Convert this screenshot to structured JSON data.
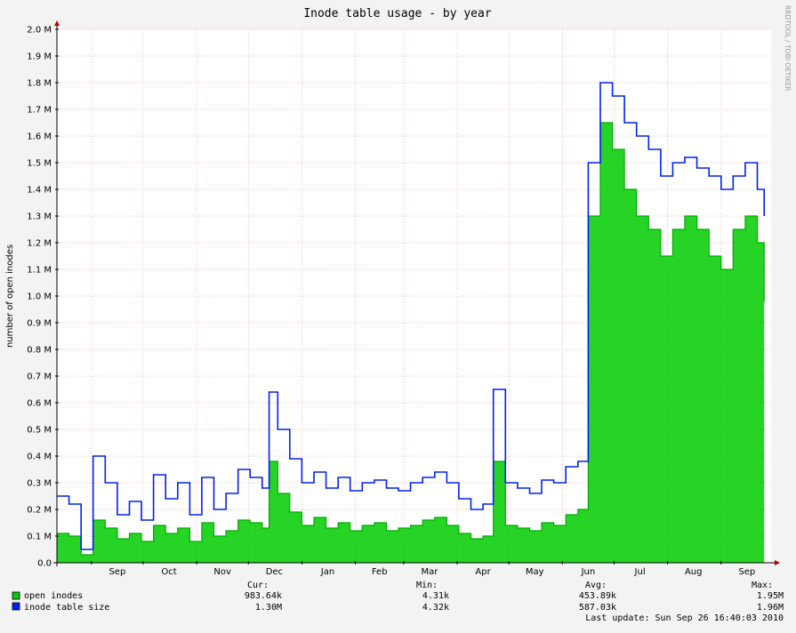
{
  "chart_data": {
    "type": "area",
    "title": "Inode table usage - by year",
    "ylabel": "number of open inodes",
    "watermark": "RRDTOOL / TOBI OETIKER",
    "ylim": [
      0,
      2000000
    ],
    "y_ticks": [
      {
        "value": 0,
        "label": "0.0"
      },
      {
        "value": 100000,
        "label": "0.1 M"
      },
      {
        "value": 200000,
        "label": "0.2 M"
      },
      {
        "value": 300000,
        "label": "0.3 M"
      },
      {
        "value": 400000,
        "label": "0.4 M"
      },
      {
        "value": 500000,
        "label": "0.5 M"
      },
      {
        "value": 600000,
        "label": "0.6 M"
      },
      {
        "value": 700000,
        "label": "0.7 M"
      },
      {
        "value": 800000,
        "label": "0.8 M"
      },
      {
        "value": 900000,
        "label": "0.9 M"
      },
      {
        "value": 1000000,
        "label": "1.0 M"
      },
      {
        "value": 1100000,
        "label": "1.1 M"
      },
      {
        "value": 1200000,
        "label": "1.2 M"
      },
      {
        "value": 1300000,
        "label": "1.3 M"
      },
      {
        "value": 1400000,
        "label": "1.4 M"
      },
      {
        "value": 1500000,
        "label": "1.5 M"
      },
      {
        "value": 1600000,
        "label": "1.6 M"
      },
      {
        "value": 1700000,
        "label": "1.7 M"
      },
      {
        "value": 1800000,
        "label": "1.8 M"
      },
      {
        "value": 1900000,
        "label": "1.9 M"
      },
      {
        "value": 2000000,
        "label": "2.0 M"
      }
    ],
    "x_range": [
      "2009-08-12",
      "2010-09-30"
    ],
    "x_month_starts": [
      "2009-09-01",
      "2009-10-01",
      "2009-11-01",
      "2009-12-01",
      "2010-01-01",
      "2010-02-01",
      "2010-03-01",
      "2010-04-01",
      "2010-05-01",
      "2010-06-01",
      "2010-07-01",
      "2010-08-01",
      "2010-09-01"
    ],
    "x_labels": [
      {
        "label": "Sep",
        "date": "2009-09-16"
      },
      {
        "label": "Oct",
        "date": "2009-10-16"
      },
      {
        "label": "Nov",
        "date": "2009-11-16"
      },
      {
        "label": "Dec",
        "date": "2009-12-16"
      },
      {
        "label": "Jan",
        "date": "2010-01-16"
      },
      {
        "label": "Feb",
        "date": "2010-02-15"
      },
      {
        "label": "Mar",
        "date": "2010-03-16"
      },
      {
        "label": "Apr",
        "date": "2010-04-16"
      },
      {
        "label": "May",
        "date": "2010-05-16"
      },
      {
        "label": "Jun",
        "date": "2010-06-16"
      },
      {
        "label": "Jul",
        "date": "2010-07-16"
      },
      {
        "label": "Aug",
        "date": "2010-08-16"
      },
      {
        "label": "Sep",
        "date": "2010-09-16"
      }
    ],
    "grid": true,
    "series": [
      {
        "name": "inode table size",
        "color": "#0022ee",
        "kind": "line",
        "points": [
          [
            "2009-08-12",
            250000
          ],
          [
            "2009-08-19",
            220000
          ],
          [
            "2009-08-26",
            50000
          ],
          [
            "2009-09-02",
            400000
          ],
          [
            "2009-09-09",
            300000
          ],
          [
            "2009-09-16",
            180000
          ],
          [
            "2009-09-23",
            230000
          ],
          [
            "2009-09-30",
            160000
          ],
          [
            "2009-10-07",
            330000
          ],
          [
            "2009-10-14",
            240000
          ],
          [
            "2009-10-21",
            300000
          ],
          [
            "2009-10-28",
            180000
          ],
          [
            "2009-11-04",
            320000
          ],
          [
            "2009-11-11",
            200000
          ],
          [
            "2009-11-18",
            260000
          ],
          [
            "2009-11-25",
            350000
          ],
          [
            "2009-12-02",
            320000
          ],
          [
            "2009-12-09",
            280000
          ],
          [
            "2009-12-13",
            640000
          ],
          [
            "2009-12-18",
            500000
          ],
          [
            "2009-12-25",
            390000
          ],
          [
            "2010-01-01",
            300000
          ],
          [
            "2010-01-08",
            340000
          ],
          [
            "2010-01-15",
            280000
          ],
          [
            "2010-01-22",
            320000
          ],
          [
            "2010-01-29",
            270000
          ],
          [
            "2010-02-05",
            300000
          ],
          [
            "2010-02-12",
            310000
          ],
          [
            "2010-02-19",
            280000
          ],
          [
            "2010-02-26",
            270000
          ],
          [
            "2010-03-05",
            300000
          ],
          [
            "2010-03-12",
            320000
          ],
          [
            "2010-03-19",
            340000
          ],
          [
            "2010-03-26",
            300000
          ],
          [
            "2010-04-02",
            240000
          ],
          [
            "2010-04-09",
            200000
          ],
          [
            "2010-04-16",
            220000
          ],
          [
            "2010-04-22",
            650000
          ],
          [
            "2010-04-29",
            300000
          ],
          [
            "2010-05-06",
            280000
          ],
          [
            "2010-05-13",
            260000
          ],
          [
            "2010-05-20",
            310000
          ],
          [
            "2010-05-27",
            300000
          ],
          [
            "2010-06-03",
            360000
          ],
          [
            "2010-06-10",
            380000
          ],
          [
            "2010-06-16",
            1500000
          ],
          [
            "2010-06-23",
            1800000
          ],
          [
            "2010-06-30",
            1750000
          ],
          [
            "2010-07-07",
            1650000
          ],
          [
            "2010-07-14",
            1600000
          ],
          [
            "2010-07-21",
            1550000
          ],
          [
            "2010-07-28",
            1450000
          ],
          [
            "2010-08-04",
            1500000
          ],
          [
            "2010-08-11",
            1520000
          ],
          [
            "2010-08-18",
            1480000
          ],
          [
            "2010-08-25",
            1450000
          ],
          [
            "2010-09-01",
            1400000
          ],
          [
            "2010-09-08",
            1450000
          ],
          [
            "2010-09-15",
            1500000
          ],
          [
            "2010-09-22",
            1400000
          ],
          [
            "2010-09-26",
            1300000
          ]
        ]
      },
      {
        "name": "open inodes",
        "color": "#00cc00",
        "kind": "area",
        "points": [
          [
            "2009-08-12",
            110000
          ],
          [
            "2009-08-19",
            100000
          ],
          [
            "2009-08-26",
            30000
          ],
          [
            "2009-09-02",
            160000
          ],
          [
            "2009-09-09",
            130000
          ],
          [
            "2009-09-16",
            90000
          ],
          [
            "2009-09-23",
            110000
          ],
          [
            "2009-09-30",
            80000
          ],
          [
            "2009-10-07",
            140000
          ],
          [
            "2009-10-14",
            110000
          ],
          [
            "2009-10-21",
            130000
          ],
          [
            "2009-10-28",
            80000
          ],
          [
            "2009-11-04",
            150000
          ],
          [
            "2009-11-11",
            100000
          ],
          [
            "2009-11-18",
            120000
          ],
          [
            "2009-11-25",
            160000
          ],
          [
            "2009-12-02",
            150000
          ],
          [
            "2009-12-09",
            130000
          ],
          [
            "2009-12-13",
            380000
          ],
          [
            "2009-12-18",
            260000
          ],
          [
            "2009-12-25",
            190000
          ],
          [
            "2010-01-01",
            140000
          ],
          [
            "2010-01-08",
            170000
          ],
          [
            "2010-01-15",
            130000
          ],
          [
            "2010-01-22",
            150000
          ],
          [
            "2010-01-29",
            120000
          ],
          [
            "2010-02-05",
            140000
          ],
          [
            "2010-02-12",
            150000
          ],
          [
            "2010-02-19",
            120000
          ],
          [
            "2010-02-26",
            130000
          ],
          [
            "2010-03-05",
            140000
          ],
          [
            "2010-03-12",
            160000
          ],
          [
            "2010-03-19",
            170000
          ],
          [
            "2010-03-26",
            140000
          ],
          [
            "2010-04-02",
            110000
          ],
          [
            "2010-04-09",
            90000
          ],
          [
            "2010-04-16",
            100000
          ],
          [
            "2010-04-22",
            380000
          ],
          [
            "2010-04-29",
            140000
          ],
          [
            "2010-05-06",
            130000
          ],
          [
            "2010-05-13",
            120000
          ],
          [
            "2010-05-20",
            150000
          ],
          [
            "2010-05-27",
            140000
          ],
          [
            "2010-06-03",
            180000
          ],
          [
            "2010-06-10",
            200000
          ],
          [
            "2010-06-16",
            1300000
          ],
          [
            "2010-06-23",
            1650000
          ],
          [
            "2010-06-30",
            1550000
          ],
          [
            "2010-07-07",
            1400000
          ],
          [
            "2010-07-14",
            1300000
          ],
          [
            "2010-07-21",
            1250000
          ],
          [
            "2010-07-28",
            1150000
          ],
          [
            "2010-08-04",
            1250000
          ],
          [
            "2010-08-11",
            1300000
          ],
          [
            "2010-08-18",
            1250000
          ],
          [
            "2010-08-25",
            1150000
          ],
          [
            "2010-09-01",
            1100000
          ],
          [
            "2010-09-08",
            1250000
          ],
          [
            "2010-09-15",
            1300000
          ],
          [
            "2010-09-22",
            1200000
          ],
          [
            "2010-09-26",
            980000
          ]
        ]
      }
    ]
  },
  "legend": {
    "headers": {
      "cur": "Cur:",
      "min": "Min:",
      "avg": "Avg:",
      "max": "Max:"
    },
    "rows": [
      {
        "name": "open inodes",
        "color": "#00cc00",
        "cur": "983.64k",
        "min": "4.31k",
        "avg": "453.89k",
        "max": "1.95M"
      },
      {
        "name": "inode table size",
        "color": "#0022ee",
        "cur": "1.30M",
        "min": "4.32k",
        "avg": "587.03k",
        "max": "1.96M"
      }
    ],
    "last_update": "Last update: Sun Sep 26 16:40:03 2010"
  }
}
